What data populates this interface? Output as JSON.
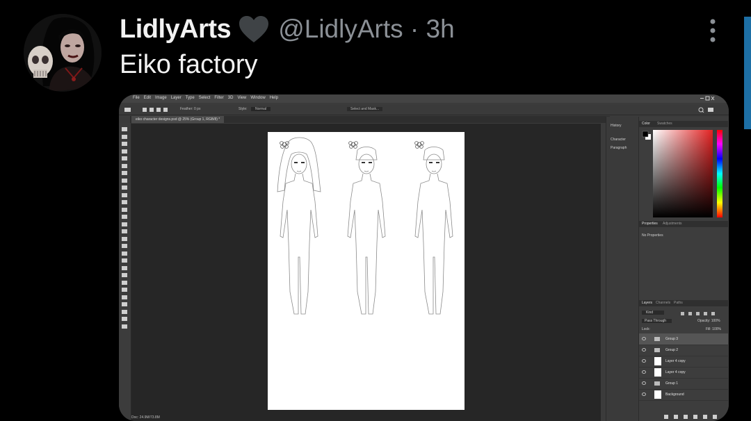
{
  "tweet": {
    "display_name": "LidlyArts",
    "handle_time": "@LidlyArts · 3h",
    "text": "Eiko factory"
  },
  "screenshot": {
    "menu": [
      "File",
      "Edit",
      "Image",
      "Layer",
      "Type",
      "Select",
      "Filter",
      "3D",
      "View",
      "Window",
      "Help"
    ],
    "options": {
      "feather": "Feather: 0 px",
      "mode_label": "Style:",
      "mode_value": "Normal",
      "select_mask": "Select and Mask..."
    },
    "doc_tab": "eiko character designs.psd @ 25% (Group 1, RGB/8) *",
    "side_panels": [
      "History",
      "Character",
      "Paragraph"
    ],
    "color_tabs": [
      "Color",
      "Swatches"
    ],
    "properties_tabs": [
      "Properties",
      "Adjustments"
    ],
    "properties_text": "No Properties",
    "layers_tabs": [
      "Layers",
      "Channels",
      "Paths"
    ],
    "layers_kind": "Kind",
    "blend_mode": "Pass Through",
    "opacity": "Opacity: 100%",
    "fill": "Fill: 100%",
    "lock": "Lock:",
    "layers": [
      {
        "name": "Group 3",
        "type": "group"
      },
      {
        "name": "Group 2",
        "type": "group"
      },
      {
        "name": "Layer 4 copy",
        "type": "layer"
      },
      {
        "name": "Layer 4 copy",
        "type": "layer"
      },
      {
        "name": "Group 1",
        "type": "group"
      },
      {
        "name": "Background",
        "type": "layer"
      }
    ],
    "status": "Doc: 24.9M/73.8M"
  }
}
